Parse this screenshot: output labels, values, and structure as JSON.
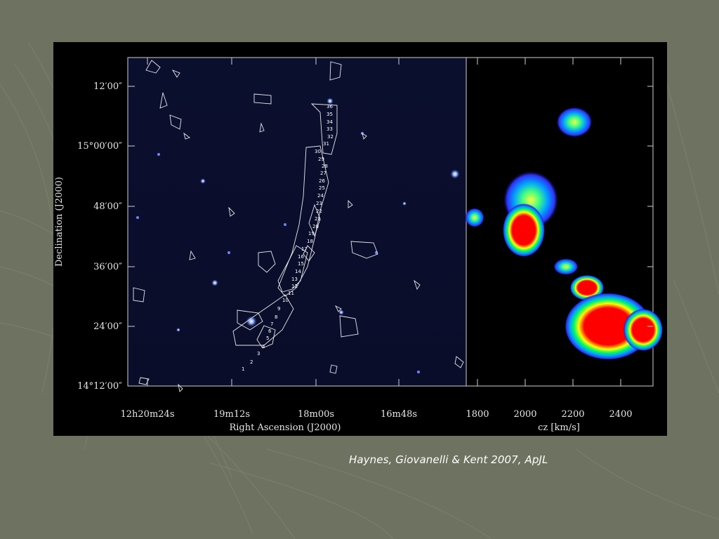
{
  "slide": {
    "background_color": "#6e7260",
    "caption": "Haynes, Giovanelli & Kent 2007, ApJL"
  },
  "figure": {
    "left_panel": {
      "y_axis_label": "Declination (J2000)",
      "x_axis_label": "Right Ascension (J2000)",
      "y_ticks": [
        "12′00″",
        "15°00′00″",
        "48′00″",
        "36′00″",
        "24′00″",
        "14°12′00″"
      ],
      "x_ticks": [
        "12h20m24s",
        "19m12s",
        "18m00s",
        "16m48s"
      ],
      "contour_labels": [
        "1",
        "2",
        "3",
        "4",
        "5",
        "6",
        "7",
        "8",
        "9",
        "10",
        "11",
        "12",
        "13",
        "14",
        "15",
        "16",
        "17",
        "18",
        "19",
        "20",
        "21",
        "22",
        "23",
        "24",
        "25",
        "26",
        "27",
        "28",
        "29",
        "30",
        "31",
        "32",
        "33",
        "34",
        "35",
        "36"
      ]
    },
    "right_panel": {
      "x_axis_label": "cz [km/s]",
      "x_ticks": [
        "1800",
        "2000",
        "2200",
        "2400"
      ]
    }
  }
}
